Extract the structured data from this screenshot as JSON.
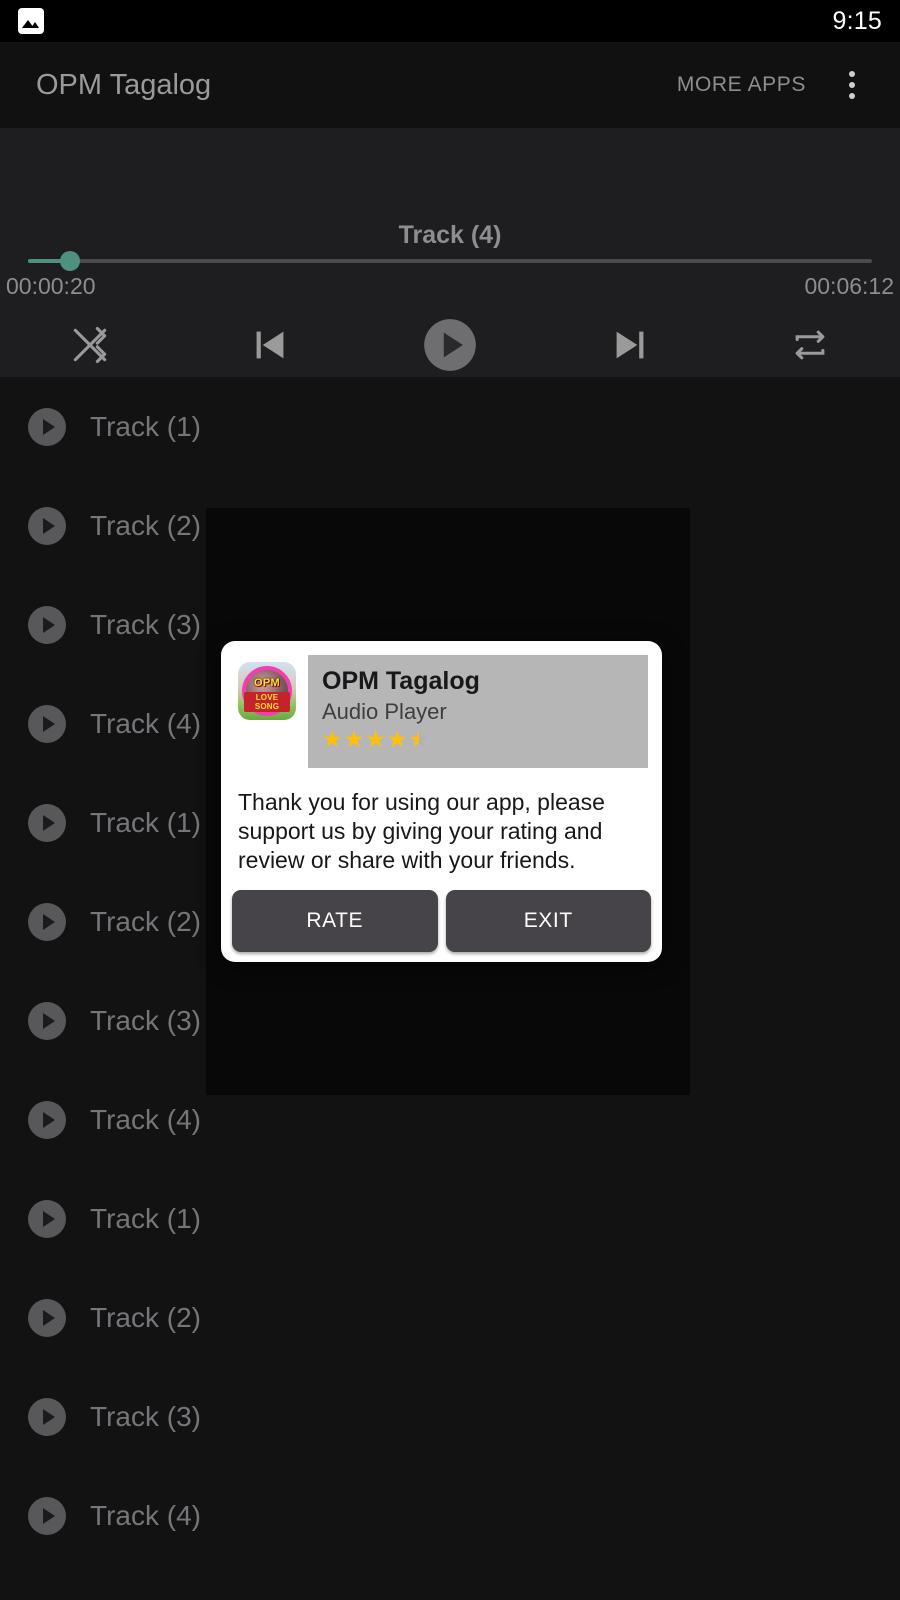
{
  "status_bar": {
    "left_icon": "photo-icon",
    "time": "9:15"
  },
  "app_bar": {
    "title": "OPM Tagalog",
    "more_apps_label": "MORE APPS",
    "overflow_icon": "overflow-menu-icon"
  },
  "player": {
    "now_playing": "Track (4)",
    "current_time": "00:00:20",
    "total_time": "00:06:12",
    "progress_percent": 5,
    "accent_color": "#4e9181",
    "controls": [
      {
        "name": "shuffle-button",
        "icon": "shuffle-icon"
      },
      {
        "name": "previous-button",
        "icon": "skip-previous-icon"
      },
      {
        "name": "play-button",
        "icon": "play-icon"
      },
      {
        "name": "next-button",
        "icon": "skip-next-icon"
      },
      {
        "name": "repeat-button",
        "icon": "repeat-icon"
      }
    ]
  },
  "track_list": {
    "items": [
      {
        "label": "Track (1)"
      },
      {
        "label": "Track (2)"
      },
      {
        "label": "Track (3)"
      },
      {
        "label": "Track (4)"
      },
      {
        "label": "Track (1)"
      },
      {
        "label": "Track (2)"
      },
      {
        "label": "Track (3)"
      },
      {
        "label": "Track (4)"
      },
      {
        "label": "Track (1)"
      },
      {
        "label": "Track (2)"
      },
      {
        "label": "Track (3)"
      },
      {
        "label": "Track (4)"
      }
    ]
  },
  "dialog": {
    "app_name": "OPM Tagalog",
    "app_subtitle": "Audio Player",
    "rating": 4.5,
    "rating_max": 5,
    "icon_text_top": "OPM",
    "icon_text_bottom": "LOVE SONG",
    "message": "Thank you for using our app, please support us by giving your rating and review or share with your friends.",
    "rate_label": "RATE",
    "exit_label": "EXIT",
    "star_color": "#ffc107",
    "button_color": "#474449"
  }
}
